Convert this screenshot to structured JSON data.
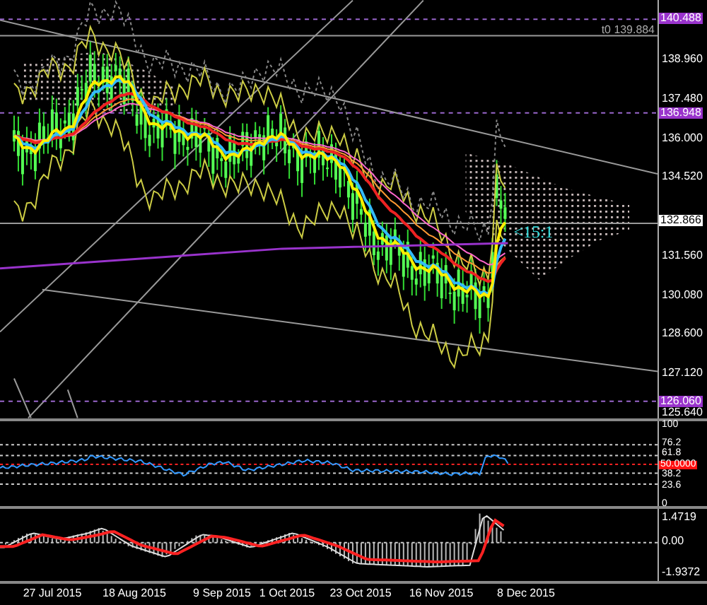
{
  "price_axis": {
    "ticks": [
      "138.960",
      "137.480",
      "136.000",
      "134.520",
      "131.560",
      "130.080",
      "128.600",
      "127.120",
      "125.640"
    ],
    "levels": [
      {
        "label": "140.488",
        "kind": "level"
      },
      {
        "label": "136.948",
        "kind": "level"
      },
      {
        "label": "132.866",
        "kind": "current"
      },
      {
        "label": "126.060",
        "kind": "level"
      }
    ]
  },
  "top_label": "t0 139.884",
  "annotation": "<15:1",
  "rsi": {
    "ticks": [
      "100",
      "76.2",
      "61.8",
      "38.2",
      "23.6",
      "0"
    ],
    "marker": "50.0000"
  },
  "macd": {
    "ticks": [
      "1.4719",
      "0.00",
      "-1.9372"
    ]
  },
  "dates": [
    "27 Jul 2015",
    "18 Aug 2015",
    "9 Sep 2015",
    "1 Oct 2015",
    "23 Oct 2015",
    "16 Nov 2015",
    "8 Dec 2015"
  ]
}
